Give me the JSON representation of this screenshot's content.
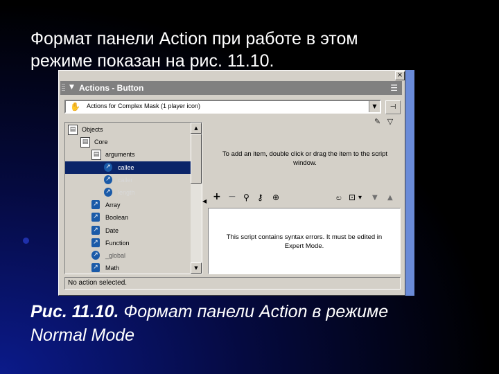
{
  "slide": {
    "heading_line1": "Формат панели Action при работе в этом",
    "heading_line2": "режиме показан на рис. 11.10.",
    "caption_line1_prefix": "Рис. 11.10.",
    "caption_line1_rest": " Формат панели Action в режиме",
    "caption_line2": "Normal Mode"
  },
  "window": {
    "close_glyph": "×",
    "title": "Actions - Button",
    "title_menu_glyph": "☰",
    "collapse_glyph": "▼",
    "scope_dropdown": {
      "icon": "✋",
      "value": "Actions for Complex Mask  (1 player icon)",
      "arrow": "▼",
      "pin_glyph": "⊣"
    },
    "tree": {
      "items": [
        {
          "label": "Objects",
          "icon": "▤",
          "kind": "book",
          "level": 0,
          "style": "normal"
        },
        {
          "label": "Core",
          "icon": "▤",
          "kind": "book",
          "level": 1,
          "style": "normal"
        },
        {
          "label": "arguments",
          "icon": "▤",
          "kind": "book",
          "level": 2,
          "style": "normal"
        },
        {
          "label": "callee",
          "icon": "↗",
          "kind": "action",
          "level": 3,
          "style": "selected"
        },
        {
          "label": "caller",
          "icon": "↗",
          "kind": "action",
          "level": 3,
          "style": "light"
        },
        {
          "label": "length",
          "icon": "↗",
          "kind": "action",
          "level": 3,
          "style": "light"
        },
        {
          "label": "Array",
          "icon": "↗",
          "kind": "action-square",
          "level": 2,
          "style": "normal"
        },
        {
          "label": "Boolean",
          "icon": "↗",
          "kind": "action-square",
          "level": 2,
          "style": "normal"
        },
        {
          "label": "Date",
          "icon": "↗",
          "kind": "action-square",
          "level": 2,
          "style": "normal"
        },
        {
          "label": "Function",
          "icon": "↗",
          "kind": "action-square",
          "level": 2,
          "style": "normal"
        },
        {
          "label": "_global",
          "icon": "↗",
          "kind": "action",
          "level": 2,
          "style": "grey"
        },
        {
          "label": "Math",
          "icon": "↗",
          "kind": "action-square",
          "level": 2,
          "style": "normal"
        }
      ],
      "scroll_up": "▲",
      "scroll_down": "▼"
    },
    "splitter_arrow": "◀",
    "right_toolbar": {
      "options_icon": "✎",
      "menu_arrow": "▽"
    },
    "hint_line1": "To add an item, double click or drag the item to the script",
    "hint_line2": "window.",
    "script_toolbar": {
      "add": "+",
      "remove": "−",
      "find": "⚲",
      "replace": "⚷",
      "target": "⊕",
      "debug": "ಲ",
      "view": "⊡",
      "view_arrow": "▾",
      "down": "▼",
      "up": "▲"
    },
    "script_msg_line1": "This script contains syntax errors.  It must be edited in",
    "script_msg_line2": "Expert Mode.",
    "status": "No action selected."
  }
}
